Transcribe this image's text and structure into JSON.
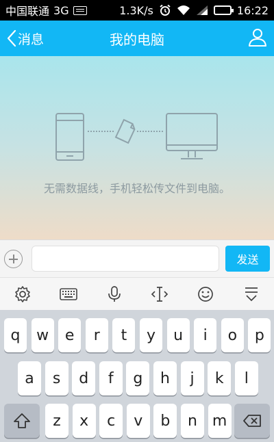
{
  "status_bar": {
    "carrier": "中国联通",
    "network": "3G",
    "speed": "1.3K/s",
    "time": "16:22",
    "icons": [
      "keyboard-icon",
      "alarm-icon",
      "wifi-icon",
      "signal-icon",
      "battery-icon"
    ]
  },
  "header": {
    "back_label": "消息",
    "title": "我的电脑",
    "accent_color": "#12b7f5"
  },
  "content": {
    "hint": "无需数据线，手机轻松传文件到电脑。"
  },
  "input_bar": {
    "value": "",
    "send_label": "发送"
  },
  "keyboard_toolbar": {
    "tools": [
      "settings-icon",
      "keyboard-icon",
      "microphone-icon",
      "cursor-icon",
      "emoji-icon",
      "hide-keyboard-icon"
    ]
  },
  "keyboard": {
    "row1": [
      "q",
      "w",
      "e",
      "r",
      "t",
      "y",
      "u",
      "i",
      "o",
      "p"
    ],
    "row2": [
      "a",
      "s",
      "d",
      "f",
      "g",
      "h",
      "j",
      "k",
      "l"
    ],
    "row3": [
      "z",
      "x",
      "c",
      "v",
      "b",
      "n",
      "m"
    ]
  }
}
